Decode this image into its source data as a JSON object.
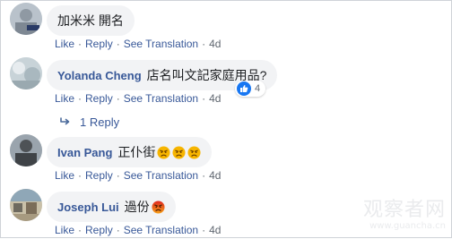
{
  "comments": [
    {
      "author": "",
      "text": "加米米 開名",
      "actions": {
        "like": "Like",
        "reply": "Reply",
        "translate": "See Translation",
        "time": "4d"
      }
    },
    {
      "author": "Yolanda Cheng",
      "text": "店名叫文記家庭用品?",
      "actions": {
        "like": "Like",
        "reply": "Reply",
        "translate": "See Translation",
        "time": "4d"
      },
      "reaction_count": "4"
    },
    {
      "author": "Ivan Pang",
      "text": "正仆街",
      "emojis": [
        "angry-face-emoji",
        "angry-face-emoji",
        "angry-face-emoji"
      ],
      "actions": {
        "like": "Like",
        "reply": "Reply",
        "translate": "See Translation",
        "time": "4d"
      }
    },
    {
      "author": "Joseph Lui",
      "text": "過份",
      "emojis": [
        "angry-red-face-emoji"
      ],
      "actions": {
        "like": "Like",
        "reply": "Reply",
        "translate": "See Translation",
        "time": "4d"
      }
    }
  ],
  "replies": {
    "label": "1 Reply"
  },
  "separator": "·",
  "watermark": {
    "title": "观察者网",
    "url": "www.guancha.cn"
  },
  "colors": {
    "link": "#385898",
    "meta": "#606770",
    "bubble": "#f2f3f5",
    "like_blue": "#1877f2"
  }
}
